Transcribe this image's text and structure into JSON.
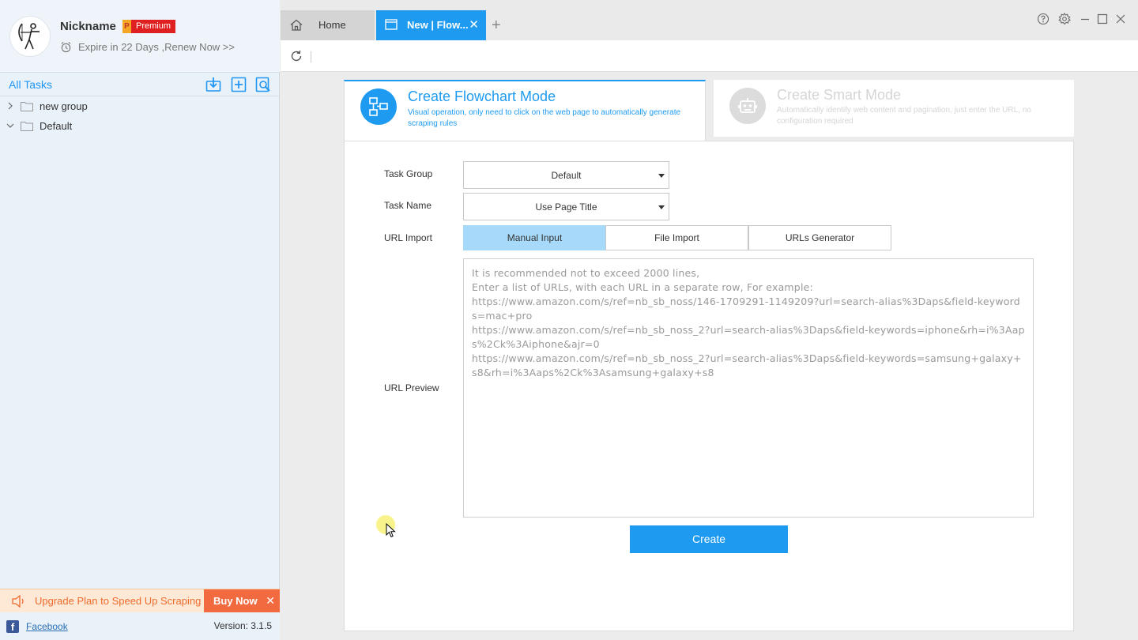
{
  "profile": {
    "nickname": "Nickname",
    "badge_letter": "P",
    "badge_label": "Premium",
    "expire_text": "Expire in 22 Days ,Renew Now >>"
  },
  "sidebar": {
    "all_tasks_label": "All Tasks",
    "header_icons": [
      "import-task-icon",
      "new-task-icon",
      "search-task-icon"
    ],
    "tree": [
      {
        "label": "new group",
        "expanded": false
      },
      {
        "label": "Default",
        "expanded": true
      }
    ],
    "upgrade_text": "Upgrade Plan to Speed Up Scraping",
    "buy_now_label": "Buy Now",
    "facebook_label": "Facebook",
    "version_text": "Version: 3.1.5"
  },
  "tabs": [
    {
      "label": "Home",
      "active": false
    },
    {
      "label": "New | Flow...",
      "active": true
    }
  ],
  "modes": {
    "flowchart": {
      "title": "Create Flowchart Mode",
      "description": "Visual operation, only need to click on the web page to automatically generate scraping rules"
    },
    "smart": {
      "title": "Create Smart Mode",
      "description": "Automatically identify web content and pagination, just enter the URL, no configuration required"
    }
  },
  "form": {
    "task_group_label": "Task Group",
    "task_group_value": "Default",
    "task_name_label": "Task Name",
    "task_name_value": "Use Page Title",
    "url_import_label": "URL Import",
    "import_options": [
      "Manual Input",
      "File Import",
      "URLs Generator"
    ],
    "active_import": "Manual Input",
    "url_preview_label": "URL Preview",
    "url_placeholder": "It is recommended not to exceed 2000 lines,\nEnter a list of URLs, with each URL in a separate row, For example:\nhttps://www.amazon.com/s/ref=nb_sb_noss/146-1709291-1149209?url=search-alias%3Daps&field-keywords=mac+pro\nhttps://www.amazon.com/s/ref=nb_sb_noss_2?url=search-alias%3Daps&field-keywords=iphone&rh=i%3Aaps%2Ck%3Aiphone&ajr=0\nhttps://www.amazon.com/s/ref=nb_sb_noss_2?url=search-alias%3Daps&field-keywords=samsung+galaxy+s8&rh=i%3Aaps%2Ck%3Asamsung+galaxy+s8",
    "create_label": "Create"
  },
  "colors": {
    "accent": "#1e9bf0",
    "active_segment": "#a7dafa",
    "buy_now": "#f26a3f",
    "upgrade_bg": "#fde9d6"
  }
}
